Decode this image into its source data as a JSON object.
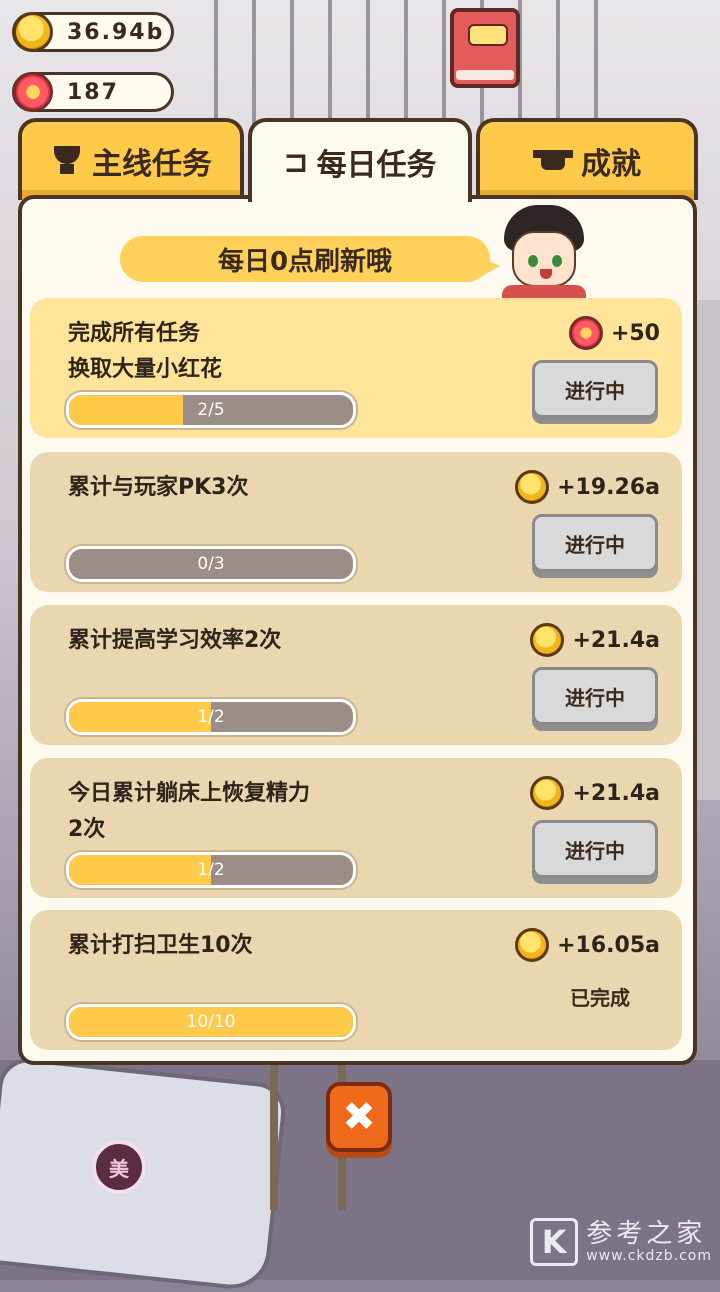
{
  "currency": {
    "coins": "36.94b",
    "flowers": "187"
  },
  "tabs": [
    {
      "label": "主线任务",
      "icon": "trophy-icon",
      "active": false
    },
    {
      "label": "每日任务",
      "icon": "calendar-icon",
      "active": true
    },
    {
      "label": "成就",
      "icon": "graduation-cap-icon",
      "active": false
    }
  ],
  "banner": "每日0点刷新哦",
  "tasks": [
    {
      "title": "完成所有任务\n换取大量小红花",
      "progress_text": "2/5",
      "progress": 0.4,
      "reward_icon": "flower-icon",
      "reward": "+50",
      "status": "进行中",
      "highlight": true
    },
    {
      "title": "累计与玩家PK3次",
      "progress_text": "0/3",
      "progress": 0.0,
      "reward_icon": "coin-icon",
      "reward": "+19.26a",
      "status": "进行中",
      "highlight": false
    },
    {
      "title": "累计提高学习效率2次",
      "progress_text": "1/2",
      "progress": 0.5,
      "reward_icon": "coin-icon",
      "reward": "+21.4a",
      "status": "进行中",
      "highlight": false
    },
    {
      "title": "今日累计躺床上恢复精力\n2次",
      "progress_text": "1/2",
      "progress": 0.5,
      "reward_icon": "coin-icon",
      "reward": "+21.4a",
      "status": "进行中",
      "highlight": false
    },
    {
      "title": "累计打扫卫生10次",
      "progress_text": "10/10",
      "progress": 1.0,
      "reward_icon": "coin-icon",
      "reward": "+16.05a",
      "status": "已完成",
      "highlight": false
    }
  ],
  "badge_text": "美",
  "watermark": {
    "main": "参考之家",
    "sub": "www.ckdzb.com",
    "logo": "K"
  },
  "colors": {
    "accent": "#ffc94a",
    "card": "#ead7b0",
    "card_highlight": "#ffe49a",
    "close_button": "#f06a1c"
  }
}
